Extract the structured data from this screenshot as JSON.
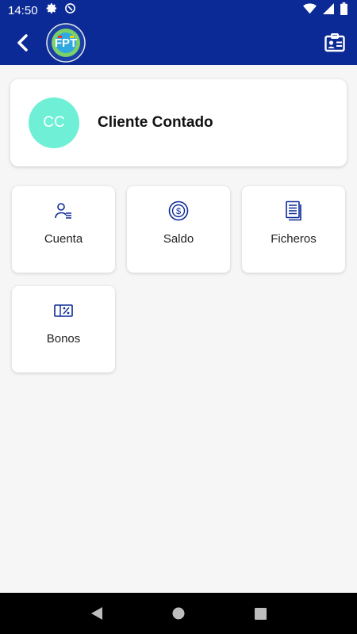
{
  "status_bar": {
    "time": "14:50"
  },
  "app_bar": {
    "logo_text": "FPT"
  },
  "profile": {
    "initials": "CC",
    "name": "Cliente Contado",
    "avatar_color": "#6ff0d6"
  },
  "tiles": [
    {
      "label": "Cuenta",
      "icon": "user-list-icon"
    },
    {
      "label": "Saldo",
      "icon": "dollar-coin-icon"
    },
    {
      "label": "Ficheros",
      "icon": "files-icon"
    },
    {
      "label": "Bonos",
      "icon": "voucher-percent-icon"
    }
  ],
  "colors": {
    "primary": "#0b2a96",
    "background": "#f6f6f6",
    "avatar": "#6ff0d6"
  }
}
